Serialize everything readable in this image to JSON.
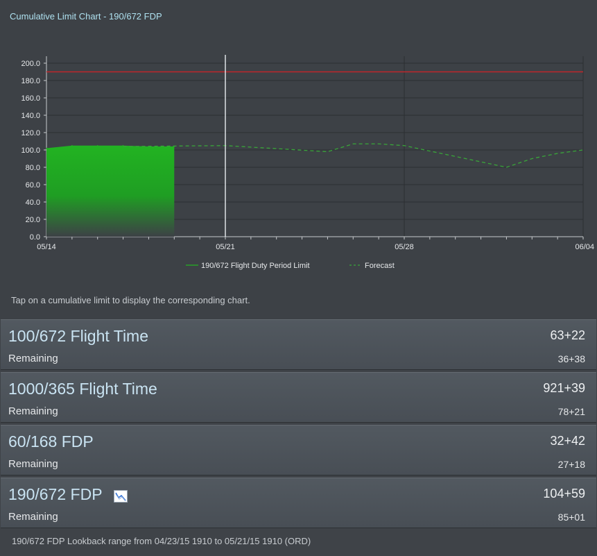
{
  "chart_title": "Cumulative Limit Chart - 190/672 FDP",
  "chart_data": {
    "type": "area",
    "x": [
      "05/14",
      "05/15",
      "05/16",
      "05/17",
      "05/18",
      "05/19"
    ],
    "series": [
      {
        "name": "190/672 Flight Duty Period Limit",
        "color": "#22b322",
        "x": [
          "05/14",
          "05/15",
          "05/16",
          "05/17",
          "05/18",
          "05/19"
        ],
        "values": [
          102,
          105,
          105,
          105,
          104,
          104
        ]
      },
      {
        "name": "Forecast",
        "color": "#39a639",
        "style": "dashed",
        "x": [
          "05/17",
          "05/21",
          "05/25",
          "05/26",
          "05/27",
          "05/28",
          "06/01",
          "06/02",
          "06/03",
          "06/04"
        ],
        "values": [
          104,
          105,
          98,
          107,
          107,
          105,
          80,
          90,
          96,
          100
        ]
      }
    ],
    "limit_line": {
      "value": 190,
      "color": "#c0262b"
    },
    "current_marker": "05/21",
    "y_ticks": [
      "200.0",
      "180.0",
      "160.0",
      "140.0",
      "120.0",
      "100.0",
      "80.0",
      "60.0",
      "40.0",
      "20.0",
      "0.0"
    ],
    "x_labels": [
      "05/14",
      "05/21",
      "05/28",
      "06/04"
    ],
    "ylim": [
      0,
      200
    ],
    "xlim": [
      "05/14",
      "06/04"
    ],
    "grid": true,
    "legend_position": "bottom-center"
  },
  "hint": "Tap on a cumulative limit to display the corresponding chart.",
  "limits": [
    {
      "title": "100/672 Flight Time",
      "value": "63+22",
      "remaining_label": "Remaining",
      "remaining": "36+38",
      "icon": ""
    },
    {
      "title": "1000/365 Flight Time",
      "value": "921+39",
      "remaining_label": "Remaining",
      "remaining": "78+21",
      "icon": ""
    },
    {
      "title": "60/168 FDP",
      "value": "32+42",
      "remaining_label": "Remaining",
      "remaining": "27+18",
      "icon": ""
    },
    {
      "title": "190/672 FDP",
      "value": "104+59",
      "remaining_label": "Remaining",
      "remaining": "85+01",
      "icon": "chart-icon"
    }
  ],
  "footer": "190/672 FDP Lookback range from 04/23/15 1910 to 05/21/15 1910 (ORD)"
}
